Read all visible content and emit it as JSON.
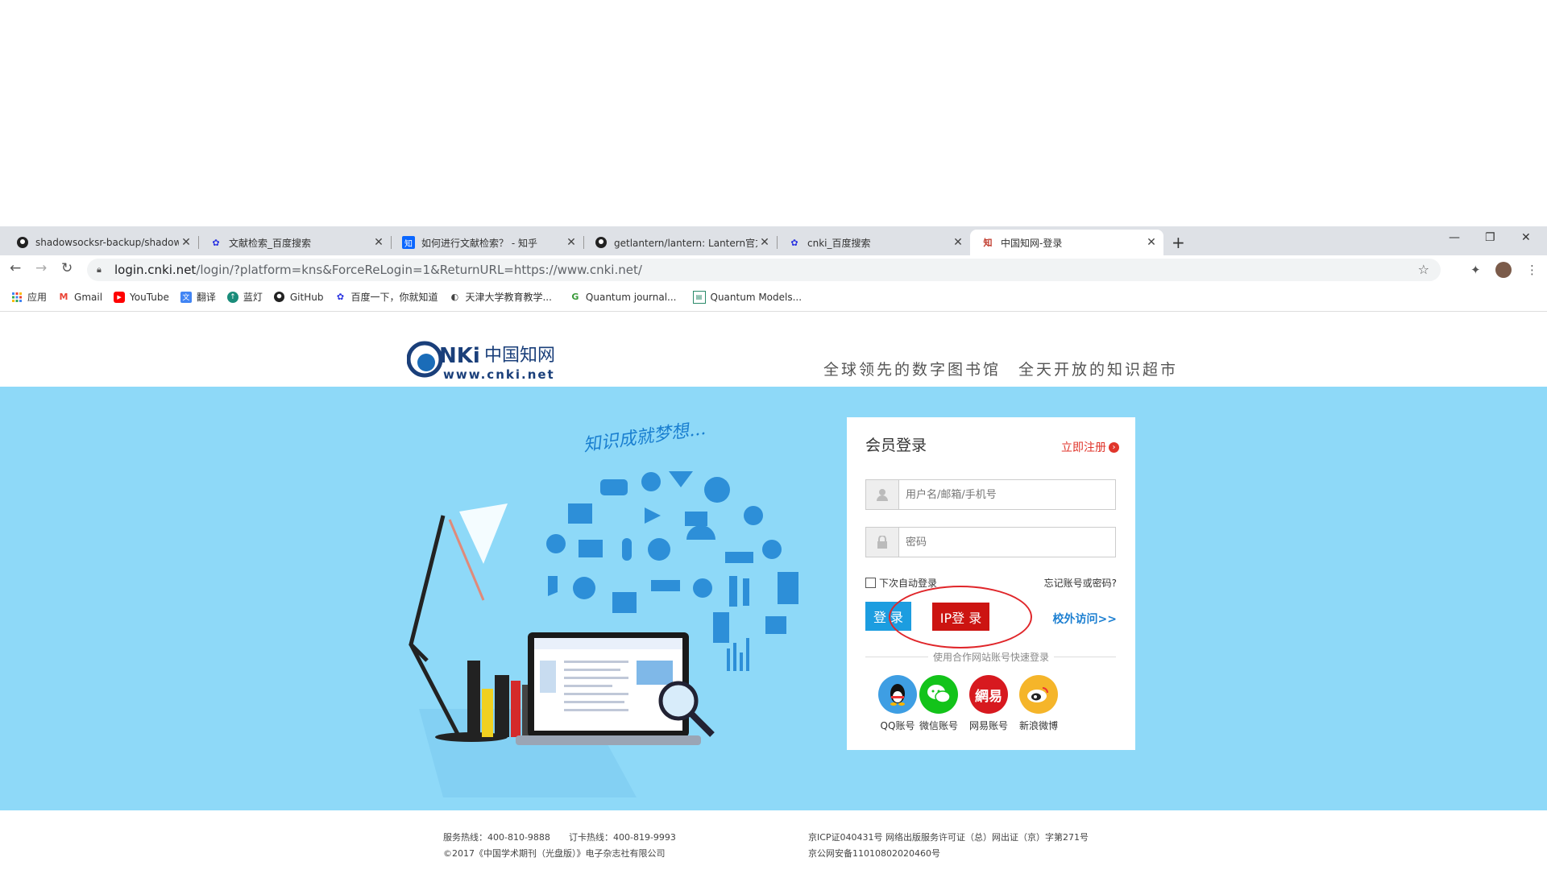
{
  "browser": {
    "tabs": [
      {
        "title": "shadowsocksr-backup/shadowsocksr",
        "favicon": "github-icon"
      },
      {
        "title": "文献检索_百度搜索",
        "favicon": "baidu-icon"
      },
      {
        "title": "如何进行文献检索？ - 知乎",
        "favicon": "zhihu-icon"
      },
      {
        "title": "getlantern/lantern: Lantern官方",
        "favicon": "github-icon"
      },
      {
        "title": "cnki_百度搜索",
        "favicon": "baidu-icon"
      },
      {
        "title": "中国知网-登录",
        "favicon": "cnki-icon",
        "active": true
      }
    ],
    "new_tab": "+",
    "window_controls": {
      "minimize": "—",
      "restore": "❐",
      "close": "✕"
    },
    "url": {
      "host": "login.cnki.net",
      "path": "/login/?platform=kns&ForceReLogin=1&ReturnURL=https://www.cnki.net/"
    },
    "bookmarks": [
      {
        "label": "应用",
        "icon": "apps-grid-icon"
      },
      {
        "label": "Gmail",
        "icon": "gmail-icon"
      },
      {
        "label": "YouTube",
        "icon": "youtube-icon"
      },
      {
        "label": "翻译",
        "icon": "translate-icon"
      },
      {
        "label": "蓝灯",
        "icon": "lantern-icon"
      },
      {
        "label": "GitHub",
        "icon": "github-icon"
      },
      {
        "label": "百度一下，你就知道",
        "icon": "baidu-icon"
      },
      {
        "label": "天津大学教育教学...",
        "icon": "globe-icon"
      },
      {
        "label": "Quantum journal...",
        "icon": "quantum-icon"
      },
      {
        "label": "Quantum Models...",
        "icon": "page-icon"
      }
    ]
  },
  "header": {
    "logo_text": "CNKi中国知网",
    "logo_url_text": "www.cnki.net",
    "slogan": "全球领先的数字图书馆　全天开放的知识超市"
  },
  "hero": {
    "illustration_caption": "知识成就梦想..."
  },
  "login": {
    "title": "会员登录",
    "register_label": "立即注册",
    "username_placeholder": "用户名/邮箱/手机号",
    "password_placeholder": "密码",
    "remember_label": "下次自动登录",
    "forgot_label": "忘记账号或密码?",
    "login_button": "登 录",
    "ip_login_button": "IP登 录",
    "outside_access": "校外访问>>",
    "divider_text": "使用合作网站账号快速登录",
    "social": [
      {
        "label": "QQ账号",
        "color": "#3e9ee3",
        "icon": "qq-icon"
      },
      {
        "label": "微信账号",
        "color": "#13c31a",
        "icon": "wechat-icon"
      },
      {
        "label": "网易账号",
        "color": "#d7191f",
        "icon": "netease-icon",
        "glyph": "網易"
      },
      {
        "label": "新浪微博",
        "color": "#f5b52a",
        "icon": "weibo-icon"
      }
    ]
  },
  "footer": {
    "service_hotline": "服务热线：400-810-9888",
    "subscribe_hotline": "订卡热线：400-819-9993",
    "copyright": "©2017《中国学术期刊（光盘版）》电子杂志社有限公司",
    "icp": "京ICP证040431号 网络出版服务许可证（总）网出证（京）字第271号",
    "police": "京公网安备11010802020460号"
  }
}
